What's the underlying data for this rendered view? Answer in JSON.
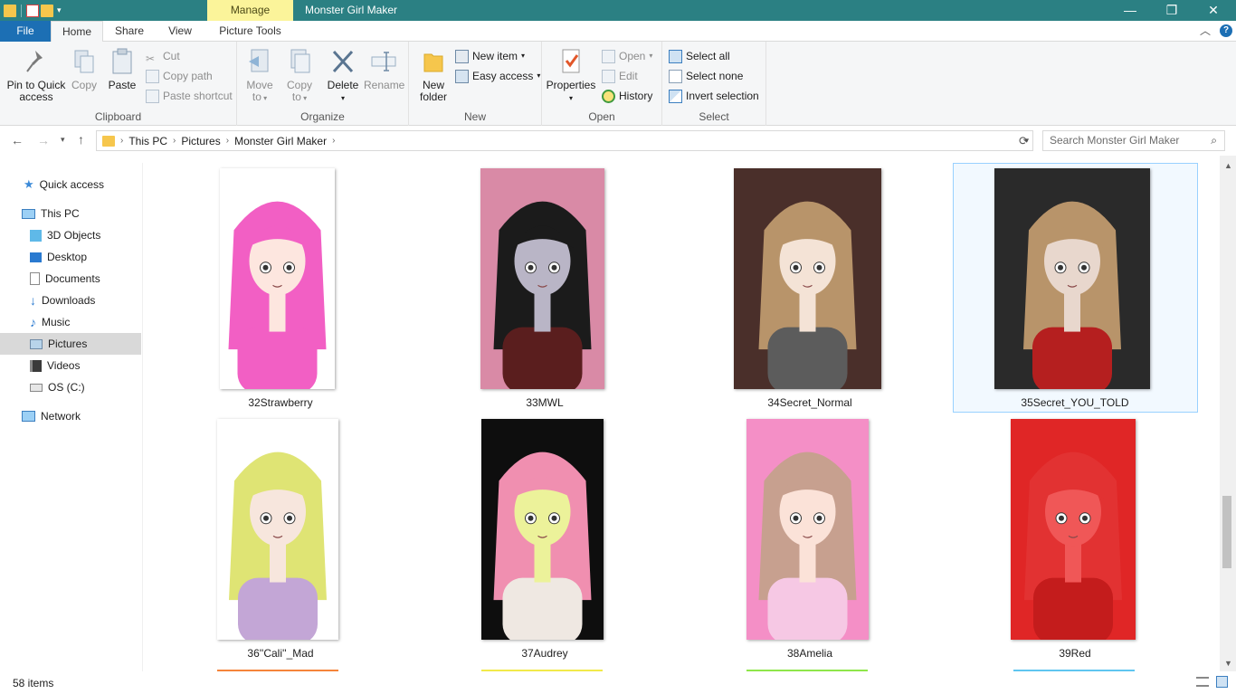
{
  "window": {
    "title": "Monster Girl Maker",
    "contextual_tab_group": "Manage",
    "buttons": {
      "minimize": "—",
      "restore": "❐",
      "close": "✕"
    }
  },
  "tabs": [
    {
      "label": "File"
    },
    {
      "label": "Home"
    },
    {
      "label": "Share"
    },
    {
      "label": "View"
    },
    {
      "label": "Picture Tools"
    }
  ],
  "ribbon": {
    "clipboard": {
      "title": "Clipboard",
      "pin": "Pin to Quick access",
      "pin_line1": "Pin to Quick",
      "pin_line2": "access",
      "copy": "Copy",
      "paste": "Paste",
      "cut": "Cut",
      "copy_path": "Copy path",
      "paste_shortcut": "Paste shortcut"
    },
    "organize": {
      "title": "Organize",
      "move_to_1": "Move",
      "move_to_2": "to",
      "copy_to_1": "Copy",
      "copy_to_2": "to",
      "delete": "Delete",
      "rename": "Rename"
    },
    "new": {
      "title": "New",
      "new_folder_1": "New",
      "new_folder_2": "folder",
      "new_item": "New item",
      "easy_access": "Easy access"
    },
    "open": {
      "title": "Open",
      "properties": "Properties",
      "open": "Open",
      "edit": "Edit",
      "history": "History"
    },
    "select": {
      "title": "Select",
      "select_all": "Select all",
      "select_none": "Select none",
      "invert": "Invert selection"
    }
  },
  "address": {
    "crumbs": [
      "This PC",
      "Pictures",
      "Monster Girl Maker"
    ],
    "search_placeholder": "Search Monster Girl Maker"
  },
  "nav": {
    "quick_access": "Quick access",
    "this_pc": "This PC",
    "items": [
      "3D Objects",
      "Desktop",
      "Documents",
      "Downloads",
      "Music",
      "Pictures",
      "Videos",
      "OS (C:)"
    ],
    "network": "Network",
    "selected": "Pictures"
  },
  "files": [
    {
      "name": "32Strawberry",
      "bg": "#ffffff",
      "hair": "#f25fc4",
      "skin": "#fde6df",
      "accent": "#f25fc4"
    },
    {
      "name": "33MWL",
      "bg": "#d98aa6",
      "hair": "#1b1b1b",
      "skin": "#b9b5c6",
      "accent": "#5a1e1e"
    },
    {
      "name": "34Secret_Normal",
      "bg": "#4a2f2a",
      "hair": "#b8946a",
      "skin": "#f4e3d6",
      "accent": "#5c5c5c"
    },
    {
      "name": "35Secret_YOU_TOLD",
      "bg": "#2a2a2a",
      "hair": "#b8946a",
      "skin": "#e8d7cd",
      "accent": "#b51f1f"
    },
    {
      "name": "36''Cali''_Mad",
      "bg": "#ffffff",
      "hair": "#dfe474",
      "skin": "#f7e6dd",
      "accent": "#c3a6d6"
    },
    {
      "name": "37Audrey",
      "bg": "#0e0e0e",
      "hair": "#f08fb0",
      "skin": "#ecf29a",
      "accent": "#efe8e2"
    },
    {
      "name": "38Amelia",
      "bg": "#f48fc6",
      "hair": "#c7a08f",
      "skin": "#fbe2d8",
      "accent": "#f6c8e4"
    },
    {
      "name": "39Red",
      "bg": "#e02626",
      "hair": "#e23232",
      "skin": "#f05757",
      "accent": "#c41c1c"
    }
  ],
  "status": {
    "item_count": "58 items"
  }
}
